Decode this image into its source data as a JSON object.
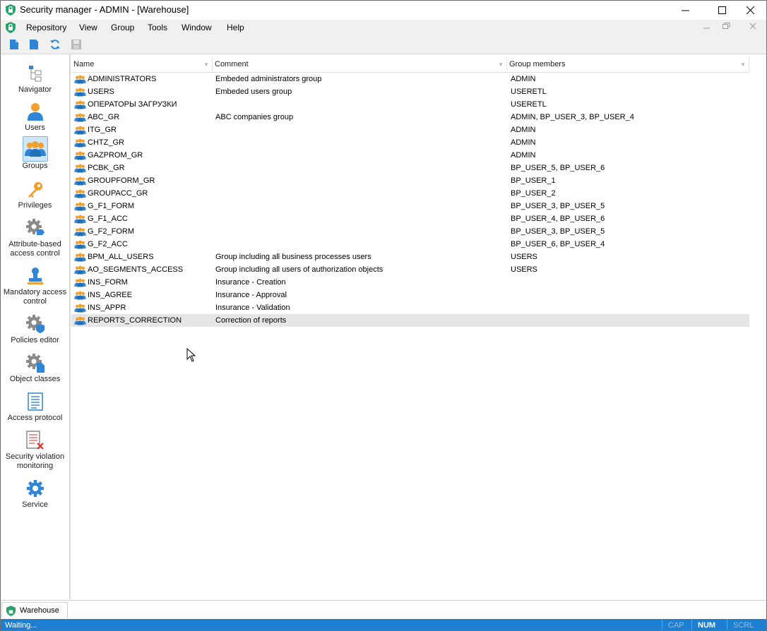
{
  "window": {
    "title": "Security manager - ADMIN - [Warehouse]"
  },
  "menu": [
    "Repository",
    "View",
    "Group",
    "Tools",
    "Window",
    "Help"
  ],
  "toolbar": {
    "buttons": [
      "new-document-icon",
      "document-icon",
      "refresh-icon",
      "save-icon"
    ]
  },
  "sidebar": {
    "items": [
      {
        "label": "Navigator",
        "icon": "navigator-tree-icon"
      },
      {
        "label": "Users",
        "icon": "user-icon"
      },
      {
        "label": "Groups",
        "icon": "group-icon",
        "selected": true
      },
      {
        "label": "Privileges",
        "icon": "key-icon"
      },
      {
        "label": "Attribute-based access control",
        "icon": "gear-tag-icon"
      },
      {
        "label": "Mandatory access control",
        "icon": "stamp-icon"
      },
      {
        "label": "Policies editor",
        "icon": "gear-shield-icon"
      },
      {
        "label": "Object classes",
        "icon": "gear-document-icon"
      },
      {
        "label": "Access protocol",
        "icon": "protocol-document-icon"
      },
      {
        "label": "Security violation monitoring",
        "icon": "violation-document-icon"
      },
      {
        "label": "Service",
        "icon": "service-gear-icon"
      }
    ]
  },
  "grid": {
    "columns": [
      "Name",
      "Comment",
      "Group members"
    ],
    "rows": [
      {
        "name": "ADMINISTRATORS",
        "comment": "Embeded administrators group",
        "members": "ADMIN"
      },
      {
        "name": "USERS",
        "comment": "Embeded users group",
        "members": "USERETL"
      },
      {
        "name": "ОПЕРАТОРЫ ЗАГРУЗКИ",
        "comment": "",
        "members": "USERETL"
      },
      {
        "name": "ABC_GR",
        "comment": "ABC companies group",
        "members": "ADMIN, BP_USER_3, BP_USER_4"
      },
      {
        "name": "ITG_GR",
        "comment": "",
        "members": "ADMIN"
      },
      {
        "name": "CHTZ_GR",
        "comment": "",
        "members": "ADMIN"
      },
      {
        "name": "GAZPROM_GR",
        "comment": "",
        "members": "ADMIN"
      },
      {
        "name": "PCBK_GR",
        "comment": "",
        "members": "BP_USER_5, BP_USER_6"
      },
      {
        "name": "GROUPFORM_GR",
        "comment": "",
        "members": "BP_USER_1"
      },
      {
        "name": "GROUPACC_GR",
        "comment": "",
        "members": "BP_USER_2"
      },
      {
        "name": "G_F1_FORM",
        "comment": "",
        "members": "BP_USER_3, BP_USER_5"
      },
      {
        "name": "G_F1_ACC",
        "comment": "",
        "members": "BP_USER_4, BP_USER_6"
      },
      {
        "name": "G_F2_FORM",
        "comment": "",
        "members": "BP_USER_3, BP_USER_5"
      },
      {
        "name": "G_F2_ACC",
        "comment": "",
        "members": "BP_USER_6, BP_USER_4"
      },
      {
        "name": "BPM_ALL_USERS",
        "comment": "Group including all business processes users",
        "members": "USERS"
      },
      {
        "name": "AO_SEGMENTS_ACCESS",
        "comment": "Group including all users of authorization objects",
        "members": "USERS"
      },
      {
        "name": "INS_FORM",
        "comment": "Insurance - Creation",
        "members": ""
      },
      {
        "name": "INS_AGREE",
        "comment": "Insurance - Approval",
        "members": ""
      },
      {
        "name": "INS_APPR",
        "comment": "Insurance - Validation",
        "members": ""
      },
      {
        "name": "REPORTS_CORRECTION",
        "comment": "Correction of reports",
        "members": "",
        "selected": true
      }
    ]
  },
  "tabs": [
    {
      "label": "Warehouse"
    }
  ],
  "status": {
    "text": "Waiting...",
    "indicators": [
      {
        "label": "CAP",
        "active": false
      },
      {
        "label": "NUM",
        "active": true
      },
      {
        "label": "SCRL",
        "active": false
      }
    ]
  },
  "colors": {
    "accent": "#1e7fd0",
    "group_icon_orange": "#f0a030",
    "group_icon_blue": "#2f86d6",
    "selected_row": "#e6e6e6"
  }
}
